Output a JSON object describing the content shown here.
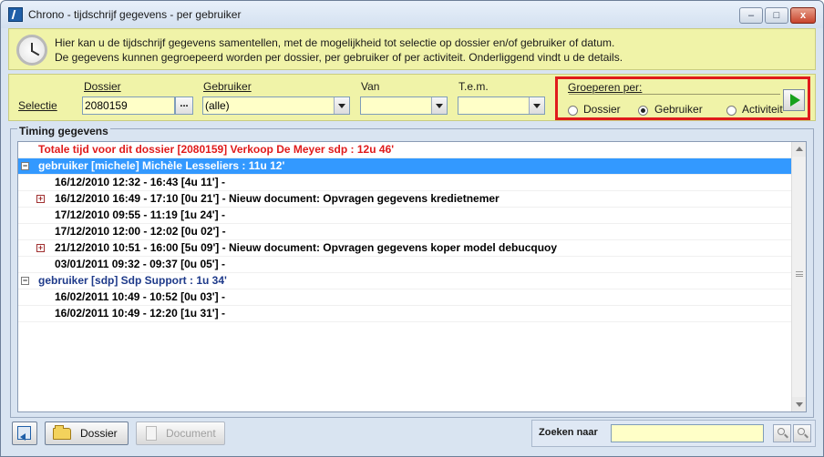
{
  "window": {
    "title": "Chrono - tijdschrijf gegevens - per gebruiker",
    "min_label": "–",
    "max_label": "□",
    "close_label": "x"
  },
  "info": {
    "line1": "Hier kan u de tijdschrijf gegevens samentellen, met de mogelijkheid tot selectie op dossier en/of gebruiker of datum.",
    "line2": "De gegevens kunnen gegroepeerd worden per dossier, per gebruiker of per activiteit.  Onderliggend vindt u de details."
  },
  "filter": {
    "selectie_label": "Selectie",
    "dossier_label": "Dossier",
    "dossier_value": "2080159",
    "ellipsis_label": "...",
    "gebruiker_label": "Gebruiker",
    "gebruiker_value": "(alle)",
    "van_label": "Van",
    "van_value": "",
    "tem_label": "T.e.m.",
    "tem_value": ""
  },
  "group": {
    "label": "Groeperen per:",
    "options": [
      "Dossier",
      "Gebruiker",
      "Activiteit"
    ],
    "selected": "Gebruiker"
  },
  "timing": {
    "title": "Timing gegevens",
    "rows": [
      {
        "indent": 0,
        "toggle": "",
        "style": "red",
        "text": "Totale tijd voor dit dossier [2080159] Verkoop De Meyer sdp : 12u 46'"
      },
      {
        "indent": 0,
        "toggle": "minus",
        "style": "sel",
        "text": "gebruiker [michele] Michèle Lesseliers : 11u 12'"
      },
      {
        "indent": 1,
        "toggle": "",
        "style": "",
        "text": "16/12/2010  12:32 - 16:43  [4u 11'] -"
      },
      {
        "indent": 1,
        "toggle": "plus",
        "style": "",
        "text": "16/12/2010  16:49 - 17:10  [0u 21'] - Nieuw document: Opvragen gegevens kredietnemer"
      },
      {
        "indent": 1,
        "toggle": "",
        "style": "",
        "text": "17/12/2010  09:55 - 11:19  [1u 24'] -"
      },
      {
        "indent": 1,
        "toggle": "",
        "style": "",
        "text": "17/12/2010  12:00 - 12:02  [0u 02'] -"
      },
      {
        "indent": 1,
        "toggle": "plus",
        "style": "",
        "text": "21/12/2010  10:51 - 16:00  [5u 09'] - Nieuw document: Opvragen gegevens koper model debucquoy"
      },
      {
        "indent": 1,
        "toggle": "",
        "style": "",
        "text": "03/01/2011  09:32 - 09:37  [0u 05'] -"
      },
      {
        "indent": 0,
        "toggle": "minus",
        "style": "blue",
        "text": "gebruiker [sdp] Sdp Support : 1u 34'"
      },
      {
        "indent": 1,
        "toggle": "",
        "style": "",
        "text": "16/02/2011  10:49 - 10:52  [0u 03'] -"
      },
      {
        "indent": 1,
        "toggle": "",
        "style": "",
        "text": "16/02/2011  10:49 - 12:20  [1u 31'] -"
      }
    ]
  },
  "toolbar": {
    "dossier_label": "Dossier",
    "document_label": "Document",
    "search_label": "Zoeken naar",
    "search_value": ""
  }
}
